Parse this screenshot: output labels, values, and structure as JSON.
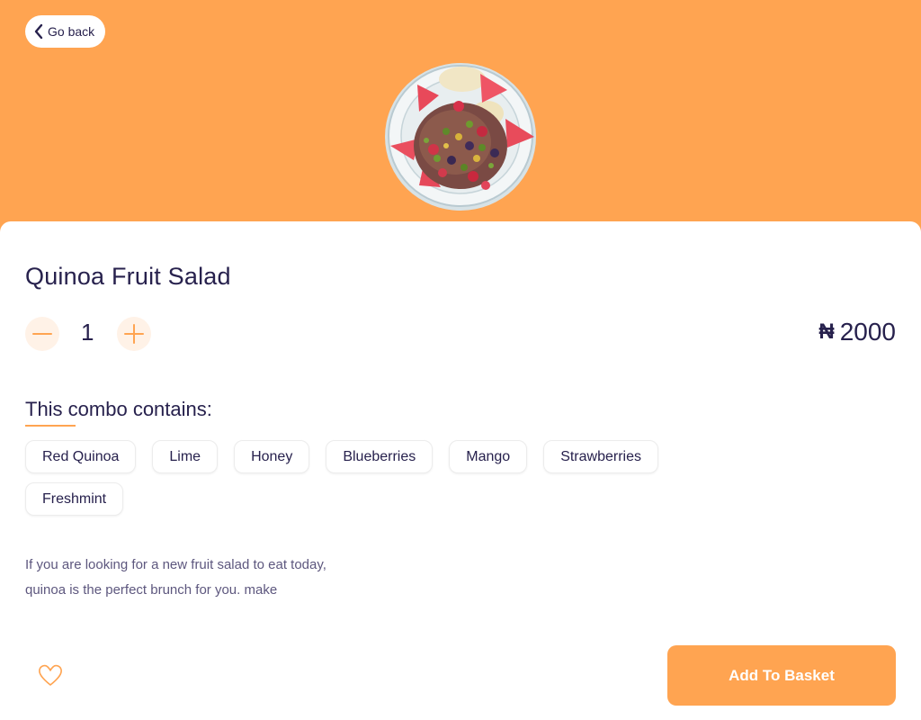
{
  "header": {
    "back_label": "Go back",
    "back_icon": "chevron-left-icon",
    "bg_color": "#FFA451"
  },
  "product": {
    "image": "fruit-salad-bowl-image",
    "name": "Quinoa Fruit Salad",
    "quantity": "1",
    "currency_symbol": "₦",
    "price": "2000"
  },
  "combo": {
    "heading": "This combo contains:",
    "items": [
      "Red Quinoa",
      "Lime",
      "Honey",
      "Blueberries",
      "Mango",
      "Strawberries",
      "Freshmint"
    ]
  },
  "description": {
    "line1": "If you are looking for a new fruit salad to eat today,",
    "line2": "quinoa is the perfect brunch for you. make"
  },
  "footer": {
    "favorite_icon": "heart-outline-icon",
    "add_label": "Add To Basket",
    "accent_color": "#FFA451"
  }
}
